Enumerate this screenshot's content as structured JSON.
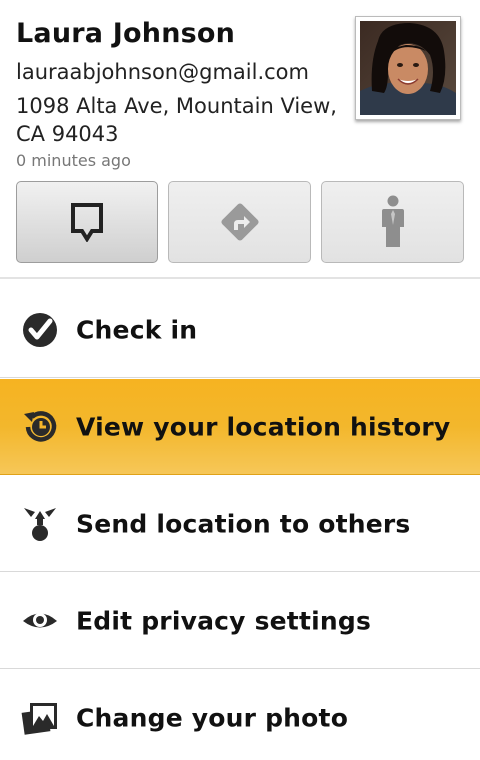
{
  "profile": {
    "name": "Laura Johnson",
    "email": "lauraabjohnson@gmail.com",
    "address": "1098 Alta Ave, Mountain View, CA 94043",
    "updated": "0 minutes ago",
    "photo_icon": "profile-photo"
  },
  "actions": [
    {
      "icon": "map-pin-icon",
      "state": "pressed"
    },
    {
      "icon": "directions-icon",
      "state": "normal"
    },
    {
      "icon": "street-view-person-icon",
      "state": "normal"
    }
  ],
  "menu": [
    {
      "label": "Check in",
      "icon": "checkmark-icon"
    },
    {
      "label": "View your location history",
      "icon": "history-clock-icon",
      "selected": true
    },
    {
      "label": "Send location to others",
      "icon": "share-location-icon"
    },
    {
      "label": "Edit privacy settings",
      "icon": "eye-icon"
    },
    {
      "label": "Change your photo",
      "icon": "photo-icon"
    }
  ],
  "colors": {
    "selected_row": "#f5b52a",
    "icon_dark": "#2b2b2b",
    "icon_gray": "#8a8a8a"
  }
}
